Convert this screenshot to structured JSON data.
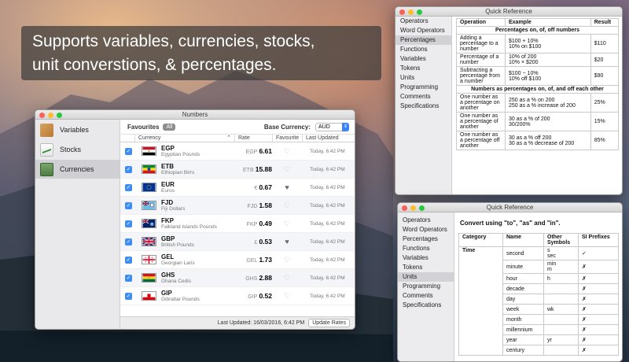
{
  "promo": {
    "line1": "Supports variables, currencies, stocks,",
    "line2": "unit converstions, & percentages."
  },
  "numbers_window": {
    "title": "Numbers",
    "sidebar": [
      {
        "label": "Variables",
        "icon": "box-icon"
      },
      {
        "label": "Stocks",
        "icon": "chart-icon"
      },
      {
        "label": "Currencies",
        "icon": "banknote-icon",
        "selected": true
      }
    ],
    "toolbar": {
      "favourites_label": "Favourites",
      "all_button": "All",
      "base_currency_label": "Base Currency:",
      "base_currency_value": "AUD"
    },
    "columns": [
      "Currency",
      "Rate",
      "Favourite",
      "Last Updated"
    ],
    "rows": [
      {
        "code": "EGP",
        "name": "Egyptian Pounds",
        "symbol": "EGP",
        "rate": "6.61",
        "favourite": false,
        "updated": "Today, 6:42 PM"
      },
      {
        "code": "ETB",
        "name": "Ethiopian Birrs",
        "symbol": "ETB",
        "rate": "15.88",
        "favourite": false,
        "updated": "Today, 6:42 PM"
      },
      {
        "code": "EUR",
        "name": "Euros",
        "symbol": "€",
        "rate": "0.67",
        "favourite": true,
        "updated": "Today, 6:42 PM"
      },
      {
        "code": "FJD",
        "name": "Fiji Dollars",
        "symbol": "FJD",
        "rate": "1.58",
        "favourite": false,
        "updated": "Today, 6:42 PM"
      },
      {
        "code": "FKP",
        "name": "Falkland Islands Pounds",
        "symbol": "FKP",
        "rate": "0.49",
        "favourite": false,
        "updated": "Today, 6:42 PM"
      },
      {
        "code": "GBP",
        "name": "British Pounds",
        "symbol": "£",
        "rate": "0.53",
        "favourite": true,
        "updated": "Today, 6:42 PM"
      },
      {
        "code": "GEL",
        "name": "Georgian Laris",
        "symbol": "GEL",
        "rate": "1.73",
        "favourite": false,
        "updated": "Today, 6:42 PM"
      },
      {
        "code": "GHS",
        "name": "Ghana Cedis",
        "symbol": "GHS",
        "rate": "2.88",
        "favourite": false,
        "updated": "Today, 6:42 PM"
      },
      {
        "code": "GIP",
        "name": "Gibraltar Pounds",
        "symbol": "GIP",
        "rate": "0.52",
        "favourite": false,
        "updated": "Today, 6:42 PM"
      }
    ],
    "footer": {
      "last_updated": "Last Updated: 16/03/2016, 6:42 PM",
      "update_button": "Update Rates"
    }
  },
  "quick_ref_1": {
    "title": "Quick Reference",
    "sidebar": [
      "Operators",
      "Word Operators",
      "Percentages",
      "Functions",
      "Variables",
      "Tokens",
      "Units",
      "Programming",
      "Comments",
      "Specifications"
    ],
    "selected": "Percentages",
    "headers": [
      "Operation",
      "Example",
      "Result"
    ],
    "section1": "Percentages on, of, off numbers",
    "rows1": [
      {
        "op": "Adding a percentage to a number",
        "example": "$100 + 10%\n10% on $100",
        "result": "$110"
      },
      {
        "op": "Percentage of a number",
        "example": "10% of 200\n10% × $200",
        "result": "$20"
      },
      {
        "op": "Subtracting a percentage from a number",
        "example": "$100 − 10%\n10% off $100",
        "result": "$90"
      }
    ],
    "section2": "Numbers as percentages on, of, and off each other",
    "rows2": [
      {
        "op": "One number as a percentage on another",
        "example": "250 as a % on 200\n250 as a % increase of 200",
        "result": "25%"
      },
      {
        "op": "One number as a percentage of another",
        "example": "30 as a % of 200\n30/200%",
        "result": "15%"
      },
      {
        "op": "One number as a percentage off another",
        "example": "30 as a % off 200\n30 as a % decrease of 200",
        "result": "85%"
      }
    ]
  },
  "quick_ref_2": {
    "title": "Quick Reference",
    "sidebar": [
      "Operators",
      "Word Operators",
      "Percentages",
      "Functions",
      "Variables",
      "Tokens",
      "Units",
      "Programming",
      "Comments",
      "Specifications"
    ],
    "selected": "Units",
    "heading": "Convert using \"to\", \"as\" and \"in\".",
    "headers": [
      "Category",
      "Name",
      "Other Symbols",
      "SI Prefixes"
    ],
    "category": "Time",
    "rows": [
      {
        "name": "second",
        "symbols": "s\nsec",
        "si": "✓"
      },
      {
        "name": "minute",
        "symbols": "min\nm",
        "si": "✗"
      },
      {
        "name": "hour",
        "symbols": "h",
        "si": "✗"
      },
      {
        "name": "decade",
        "symbols": "",
        "si": "✗"
      },
      {
        "name": "day",
        "symbols": "",
        "si": "✗"
      },
      {
        "name": "week",
        "symbols": "wk",
        "si": "✗"
      },
      {
        "name": "month",
        "symbols": "",
        "si": "✗"
      },
      {
        "name": "millennium",
        "symbols": "",
        "si": "✗"
      },
      {
        "name": "year",
        "symbols": "yr",
        "si": "✗"
      },
      {
        "name": "century",
        "symbols": "",
        "si": "✗"
      }
    ]
  }
}
